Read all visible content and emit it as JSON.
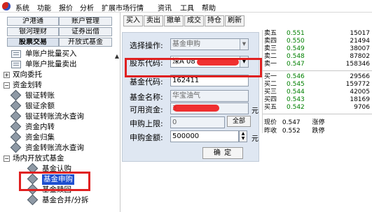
{
  "menu": {
    "items": [
      "系统",
      "功能",
      "报价",
      "分析",
      "扩展市场行情",
      "资讯",
      "工具",
      "帮助"
    ]
  },
  "left_tabs": [
    {
      "label": "沪港通"
    },
    {
      "label": "账户管理"
    },
    {
      "label": "银河理财"
    },
    {
      "label": "证券出借"
    },
    {
      "label": "股票交易"
    },
    {
      "label": "开放式基金"
    }
  ],
  "tree": [
    {
      "label": "单账户批量买入",
      "icon": "document-icon"
    },
    {
      "label": "单账户批量卖出",
      "icon": "document-icon"
    },
    {
      "label": "双向委托",
      "icon": "expand-icon",
      "toggle": "+"
    },
    {
      "label": "资金划转",
      "icon": "collapse-icon",
      "toggle": "−"
    },
    {
      "label": "银证转账",
      "icon": "gem-icon"
    },
    {
      "label": "银证余额",
      "icon": "gem-icon"
    },
    {
      "label": "银证转账流水查询",
      "icon": "gem-icon"
    },
    {
      "label": "资金内转",
      "icon": "gem-icon"
    },
    {
      "label": "资金归集",
      "icon": "gem-icon"
    },
    {
      "label": "资金转账流水查询",
      "icon": "gem-icon"
    },
    {
      "label": "场内开放式基金",
      "icon": "collapse-icon",
      "toggle": "−"
    },
    {
      "label": "基金认购",
      "icon": "gem-icon"
    },
    {
      "label": "基金申购",
      "icon": "gem-icon"
    },
    {
      "label": "基金赎回",
      "icon": "gem-icon"
    },
    {
      "label": "基金合并/分拆",
      "icon": "gem-icon"
    }
  ],
  "toolbar": [
    "买入",
    "卖出",
    "撤单",
    "成交",
    "持仓",
    "刷新"
  ],
  "form": {
    "operation_label": "选择操作:",
    "operation_value": "基金申购",
    "account_label": "股东代码:",
    "account_value": "深A 08",
    "fund_code_label": "基金代码:",
    "fund_code_value": "162411",
    "fund_name_label": "基金名称:",
    "fund_name_value": "华宝油气",
    "available_label": "可用资金:",
    "available_value": "3",
    "available_unit": "元",
    "limit_label": "申购上限:",
    "limit_value": "0",
    "full_button": "全部",
    "amount_label": "申购金额:",
    "amount_value": "500000",
    "amount_unit": "元",
    "confirm": "确 定"
  },
  "quotes": {
    "asks": [
      {
        "label": "卖五",
        "price": "0.551",
        "volume": "15017"
      },
      {
        "label": "卖四",
        "price": "0.550",
        "volume": "21494"
      },
      {
        "label": "卖三",
        "price": "0.549",
        "volume": "38007"
      },
      {
        "label": "卖二",
        "price": "0.548",
        "volume": "87802"
      },
      {
        "label": "卖一",
        "price": "0.547",
        "volume": "158346"
      }
    ],
    "bids": [
      {
        "label": "买一",
        "price": "0.546",
        "volume": "29566"
      },
      {
        "label": "买二",
        "price": "0.545",
        "volume": "159772"
      },
      {
        "label": "买三",
        "price": "0.544",
        "volume": "42005"
      },
      {
        "label": "买四",
        "price": "0.543",
        "volume": "18169"
      },
      {
        "label": "买五",
        "price": "0.542",
        "volume": "9706"
      }
    ],
    "current_label": "现价",
    "current_value": "0.547",
    "limit_up": "涨停",
    "prev_close_label": "昨收",
    "prev_close_value": "0.552",
    "limit_down": "跌停"
  },
  "colors": {
    "quote_price": "#008000",
    "highlight": "#e02020",
    "selected": "#1e4fd0"
  }
}
